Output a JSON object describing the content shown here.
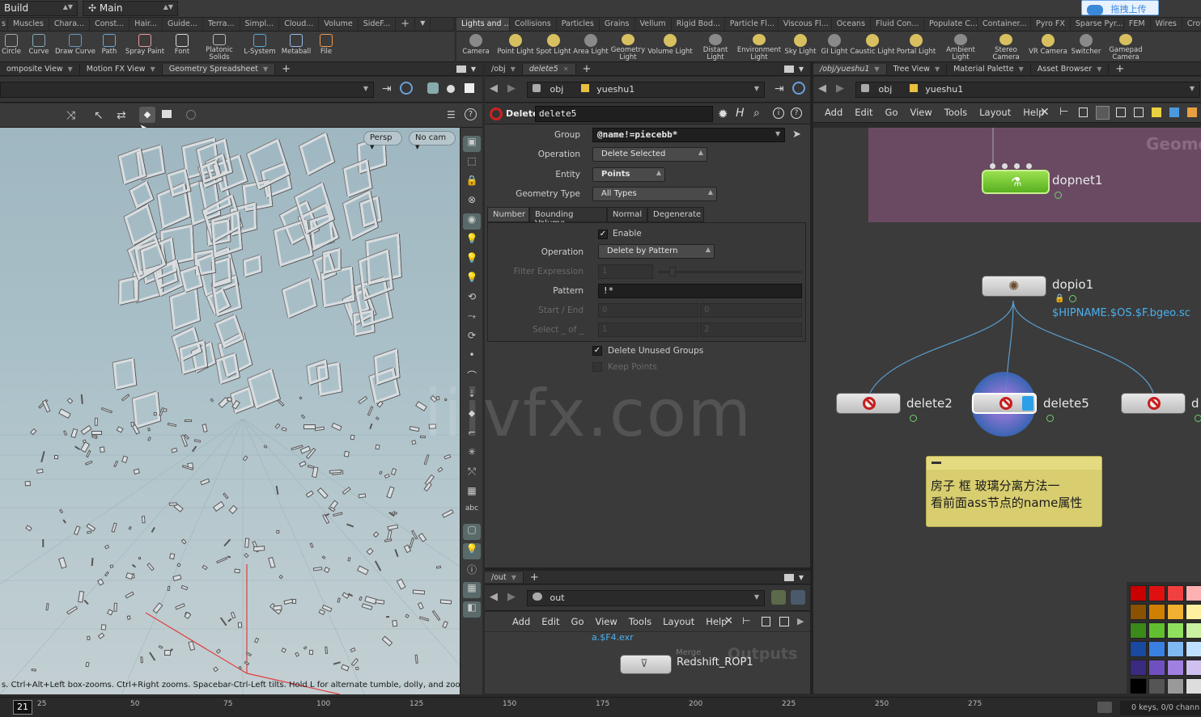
{
  "topbar": {
    "desktop_label": "Build",
    "desk_label": "Main",
    "upload_label": "拖拽上传"
  },
  "shelf_left_tabs": [
    "Muscles",
    "Chara...",
    "Const...",
    "Hair...",
    "Guide...",
    "Terra...",
    "Simpl...",
    "Cloud...",
    "Volume",
    "SideF..."
  ],
  "shelf_left_tools": [
    "Circle",
    "Curve",
    "Draw Curve",
    "Path",
    "Spray Paint",
    "Font",
    "Platonic Solids",
    "L-System",
    "Metaball",
    "File"
  ],
  "shelf_right_tabs": [
    "Lights and ...",
    "Collisions",
    "Particles",
    "Grains",
    "Vellum",
    "Rigid Bod...",
    "Particle Fl...",
    "Viscous Fl...",
    "Oceans",
    "Fluid Con...",
    "Populate C...",
    "Container...",
    "Pyro FX",
    "Sparse Pyr...",
    "FEM",
    "Wires",
    "Crowds",
    "Drive Sim..."
  ],
  "shelf_right_tools": [
    "Camera",
    "Point Light",
    "Spot Light",
    "Area Light",
    "Geometry Light",
    "Volume Light",
    "Distant Light",
    "Environment Light",
    "Sky Light",
    "GI Light",
    "Caustic Light",
    "Portal Light",
    "Ambient Light",
    "Stereo Camera",
    "VR Camera",
    "Switcher",
    "Gamepad Camera"
  ],
  "left_pane": {
    "tabs": [
      "omposite View",
      "Motion FX View",
      "Geometry Spreadsheet"
    ],
    "persp_label": "Persp",
    "cam_label": "No cam",
    "status_text": "s. Ctrl+Alt+Left box-zooms. Ctrl+Right zooms. Spacebar-Ctrl-Left tilts. Hold L for alternate tumble, dolly, and zoom.",
    "side_tool_label": "abc"
  },
  "params_pane": {
    "tabs": [
      "/obj",
      "delete5"
    ],
    "path_obj": "obj",
    "path_node": "yueshu1",
    "node_type": "Delete",
    "node_name": "delete5",
    "group_label": "Group",
    "group_value": "@name!=piecebb*",
    "operation_label": "Operation",
    "operation_value": "Delete Selected",
    "entity_label": "Entity",
    "entity_value": "Points",
    "geo_type_label": "Geometry Type",
    "geo_type_value": "All Types",
    "sub_tabs": [
      "Number",
      "Bounding Volume",
      "Normal",
      "Degenerate"
    ],
    "enable_label": "Enable",
    "op2_label": "Operation",
    "op2_value": "Delete by Pattern",
    "filter_label": "Filter Expression",
    "filter_value": "1",
    "pattern_label": "Pattern",
    "pattern_value": "!*",
    "start_end_label": "Start / End",
    "start_value": "0",
    "end_value": "0",
    "select_label": "Select _ of _",
    "select_a": "1",
    "select_b": "2",
    "delete_unused_label": "Delete Unused Groups",
    "keep_points_label": "Keep Points"
  },
  "network_pane": {
    "tabs": [
      "/obj/yueshu1",
      "Tree View",
      "Material Palette",
      "Asset Browser"
    ],
    "path_obj": "obj",
    "path_node": "yueshu1",
    "menu": [
      "Add",
      "Edit",
      "Go",
      "View",
      "Tools",
      "Layout",
      "Help"
    ],
    "network_box_label": "Geome",
    "nodes": {
      "dopnet": "dopnet1",
      "dopio": "dopio1",
      "dopio_file": "$HIPNAME.$OS.$F.bgeo.sc",
      "delete2": "delete2",
      "delete5": "delete5",
      "delete_right": "d"
    },
    "sticky_note": [
      "房子 框 玻璃分离方法一",
      "看前面ass节点的name属性"
    ]
  },
  "out_pane": {
    "tab": "/out",
    "path": "out",
    "menu": [
      "Add",
      "Edit",
      "Go",
      "View",
      "Tools",
      "Layout",
      "Help"
    ],
    "file_text": "a.$F4.exr",
    "merge_label": "Merge",
    "rop_label": "Redshift_ROP1",
    "box_label": "Outputs"
  },
  "watermark": "iiivfx.com",
  "timeline": {
    "current_frame": "21",
    "ticks": [
      "25",
      "50",
      "75",
      "100",
      "125",
      "150",
      "175",
      "200",
      "225",
      "250",
      "275"
    ],
    "keys_text": "0 keys, 0/0 chann"
  },
  "palette": {
    "colors": [
      "#c80000",
      "#e01010",
      "#f04040",
      "#ffb0b0",
      "#8a5200",
      "#d08000",
      "#f0b030",
      "#fff0a0",
      "#3a8a1a",
      "#60c030",
      "#90e060",
      "#c8f0a0",
      "#1a4aa0",
      "#3a80e0",
      "#80b8f0",
      "#c0e0ff",
      "#3a2a80",
      "#7050c0",
      "#a080e0",
      "#d0c0f0",
      "#000000",
      "#555555",
      "#999999",
      "#dddddd"
    ]
  }
}
